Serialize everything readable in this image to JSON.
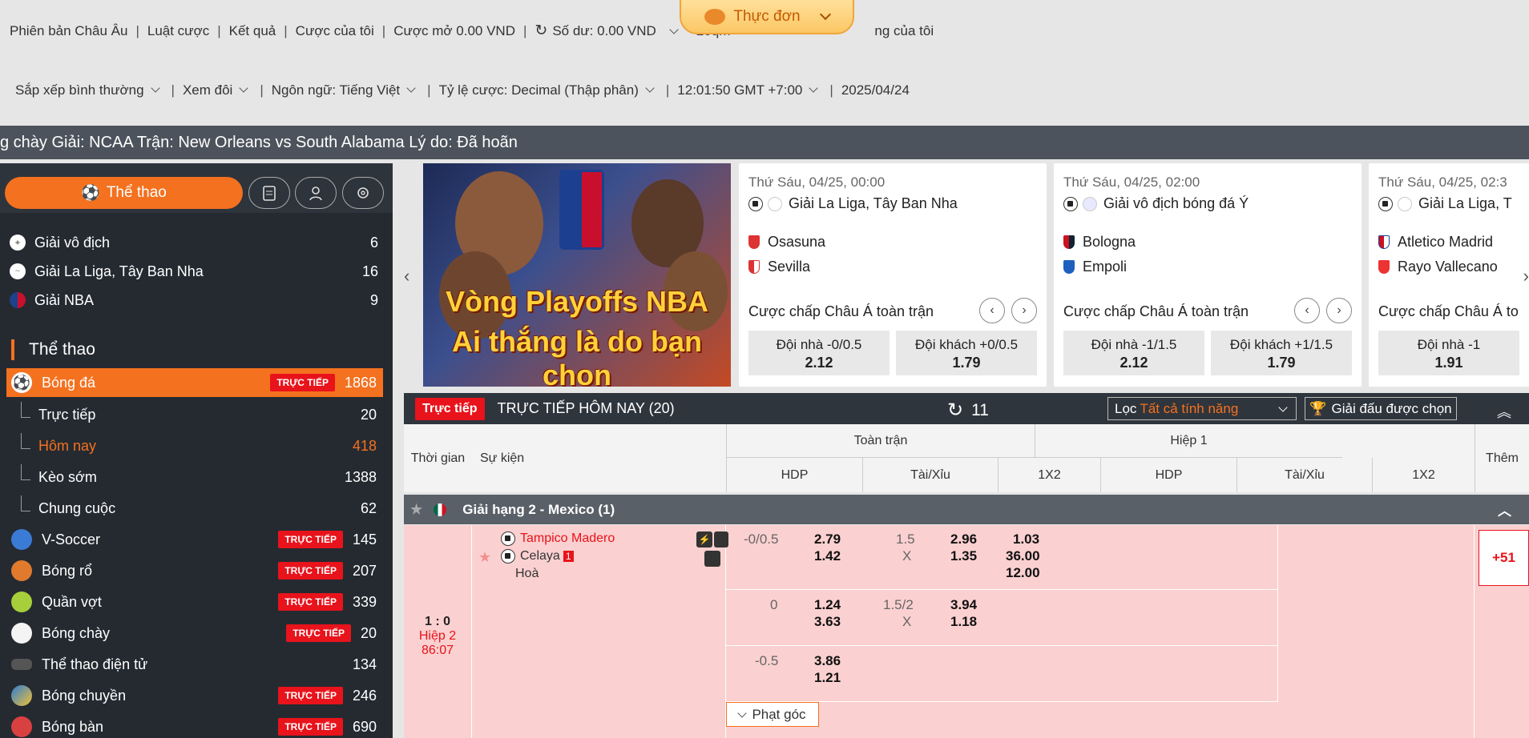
{
  "header": {
    "row1": [
      "Phiên bản Châu Âu",
      "Luật cược",
      "Kết quả",
      "Cược của tôi",
      "Cược mở 0.00 VND",
      "Số dư:  0.00 VND",
      "20qm",
      "ng của tôi"
    ],
    "menu_label": "Thực đơn",
    "row2": [
      "Sắp xếp bình thường",
      "Xem đôi",
      "Ngôn ngữ:  Tiếng Việt",
      "Tỷ lệ cược:  Decimal (Thập phân)",
      "12:01:50 GMT +7:00",
      "2025/04/24"
    ]
  },
  "ticker": "g chày Giải: NCAA Trận: New Orleans vs South Alabama Lý do: Đã hoãn",
  "sidebar": {
    "sport_button": "Thể thao",
    "leagues": [
      {
        "name": "Giải vô địch",
        "count": "6"
      },
      {
        "name": "Giải La Liga, Tây Ban Nha",
        "count": "16"
      },
      {
        "name": "Giải NBA",
        "count": "9"
      }
    ],
    "section_title": "Thể thao",
    "live_label": "TRỰC TIẾP",
    "football": {
      "name": "Bóng đá",
      "count": "1868"
    },
    "subs": [
      {
        "name": "Trực tiếp",
        "count": "20"
      },
      {
        "name": "Hôm nay",
        "count": "418"
      },
      {
        "name": "Kèo sớm",
        "count": "1388"
      },
      {
        "name": "Chung cuộc",
        "count": "62"
      }
    ],
    "sports": [
      {
        "name": "V-Soccer",
        "count": "145",
        "live": true
      },
      {
        "name": "Bóng rổ",
        "count": "207",
        "live": true
      },
      {
        "name": "Quần vợt",
        "count": "339",
        "live": true
      },
      {
        "name": "Bóng chày",
        "count": "20",
        "live": true
      },
      {
        "name": "Thể thao điện tử",
        "count": "134",
        "live": false
      },
      {
        "name": "Bóng chuyền",
        "count": "246",
        "live": true
      },
      {
        "name": "Bóng bàn",
        "count": "690",
        "live": true
      }
    ]
  },
  "banner": {
    "line1": "Vòng Playoffs NBA",
    "line2": "Ai thắng là do bạn chọn",
    "logo": "NBA"
  },
  "cards": [
    {
      "date": "Thứ Sáu, 04/25, 00:00",
      "league": "Giải La Liga, Tây Ban Nha",
      "home": "Osasuna",
      "away": "Sevilla",
      "market": "Cược chấp Châu Á toàn trận",
      "home_label": "Đội nhà -0/0.5",
      "home_odd": "2.12",
      "away_label": "Đội khách +0/0.5",
      "away_odd": "1.79"
    },
    {
      "date": "Thứ Sáu, 04/25, 02:00",
      "league": "Giải vô địch bóng đá Ý",
      "home": "Bologna",
      "away": "Empoli",
      "market": "Cược chấp Châu Á toàn trận",
      "home_label": "Đội nhà -1/1.5",
      "home_odd": "2.12",
      "away_label": "Đội khách +1/1.5",
      "away_odd": "1.79"
    },
    {
      "date": "Thứ Sáu, 04/25, 02:3",
      "league": "Giải La Liga, T",
      "home": "Atletico Madrid",
      "away": "Rayo Vallecano",
      "market": "Cược chấp Châu Á to",
      "home_label": "Đội nhà -1",
      "home_odd": "1.91"
    }
  ],
  "live": {
    "tag": "Trực tiếp",
    "title": "TRỰC TIẾP HÔM NAY (20)",
    "refresh_count": "11",
    "filter_label": "Lọc",
    "filter_value": "Tất cả tính năng",
    "chosen_label": "Giải đấu được chọn"
  },
  "table": {
    "time": "Thời gian",
    "event": "Sự kiện",
    "full": "Toàn trận",
    "half": "Hiệp 1",
    "hdp": "HDP",
    "ou": "Tài/Xỉu",
    "x12": "1X2",
    "more": "Thêm"
  },
  "league_row": "Giải hạng 2 - Mexico (1)",
  "match": {
    "score": "1 : 0",
    "period": "Hiệp 2",
    "clock": "86:07",
    "home": "Tampico Madero",
    "away": "Celaya",
    "red": "1",
    "draw": "Hoà",
    "more": "+51",
    "rows": [
      {
        "hdp": "-0/0.5",
        "h1": "2.79",
        "h2": "1.42",
        "ou": "1.5",
        "oux": "X",
        "o1": "2.96",
        "o2": "1.35",
        "x1": "1.03",
        "x2": "36.00",
        "x3": "12.00"
      },
      {
        "hdp": "0",
        "h1": "1.24",
        "h2": "3.63",
        "ou": "1.5/2",
        "oux": "X",
        "o1": "3.94",
        "o2": "1.18"
      },
      {
        "hdp": "-0.5",
        "h1": "3.86",
        "h2": "1.21"
      }
    ],
    "corner": "Phạt góc"
  }
}
